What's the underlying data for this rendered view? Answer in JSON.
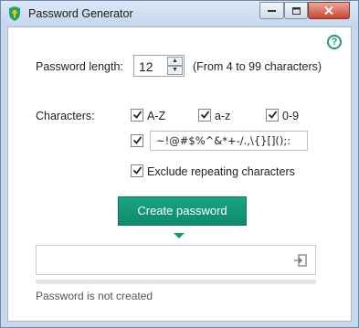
{
  "window": {
    "title": "Password Generator"
  },
  "length": {
    "label": "Password length:",
    "value": "12",
    "range_note": "(From 4 to 99 characters)"
  },
  "characters": {
    "label": "Characters:",
    "options": [
      {
        "label": "A-Z",
        "checked": true
      },
      {
        "label": "a-z",
        "checked": true
      },
      {
        "label": "0-9",
        "checked": true
      }
    ],
    "special": {
      "checked": true,
      "value": "~!@#$%^&*+-/.,\\{}[]();:"
    },
    "exclude_repeating": {
      "label": "Exclude repeating characters",
      "checked": true
    }
  },
  "actions": {
    "create_label": "Create password"
  },
  "output": {
    "value": "",
    "strength": 0
  },
  "status": "Password is not created",
  "colors": {
    "accent": "#15957a",
    "help": "#1f9a72"
  }
}
